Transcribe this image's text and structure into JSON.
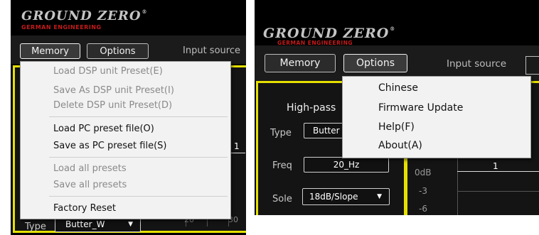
{
  "brand": {
    "logo_text": "GROUND ZERO",
    "reg_mark": "®",
    "tagline": "GERMAN ENGINEERING"
  },
  "toolbar": {
    "memory_label": "Memory",
    "options_label": "Options",
    "input_source_label": "Input source"
  },
  "memory_menu": {
    "items": [
      {
        "label": "Load DSP unit Preset(E)",
        "enabled": false
      },
      {
        "label": "Save As DSP unit Preset(I)",
        "enabled": false
      },
      {
        "label": "Delete DSP unit Preset(D)",
        "enabled": false
      },
      {
        "label": "Load PC preset file(O)",
        "enabled": true
      },
      {
        "label": "Save as PC preset file(S)",
        "enabled": true
      },
      {
        "label": "Load all presets",
        "enabled": false
      },
      {
        "label": "Save all presets",
        "enabled": false
      },
      {
        "label": "Factory Reset",
        "enabled": true
      }
    ]
  },
  "options_menu": {
    "items": [
      {
        "label": "Chinese"
      },
      {
        "label": "Firmware Update"
      },
      {
        "label": "Help(F)"
      },
      {
        "label": "About(A)"
      }
    ]
  },
  "left_panel": {
    "type_label": "Type",
    "type_value": "Butter_W",
    "graph_tick_20": "20",
    "graph_tick_30": "30",
    "graph_marker": "1"
  },
  "right_panel": {
    "highpass_label": "High-pass",
    "type_label": "Type",
    "type_value": "Butter",
    "freq_label": "Freq",
    "freq_value": "20_Hz",
    "slope_label": "Sole",
    "slope_value": "18dB/Slope",
    "graph_ticks": [
      "0dB",
      "-3",
      "-6"
    ],
    "graph_marker": "1"
  },
  "colors": {
    "accent_frame": "#e5e000",
    "brand_red": "#c41a1a"
  },
  "icons": {
    "dropdown": "dropdown-arrow-icon"
  }
}
